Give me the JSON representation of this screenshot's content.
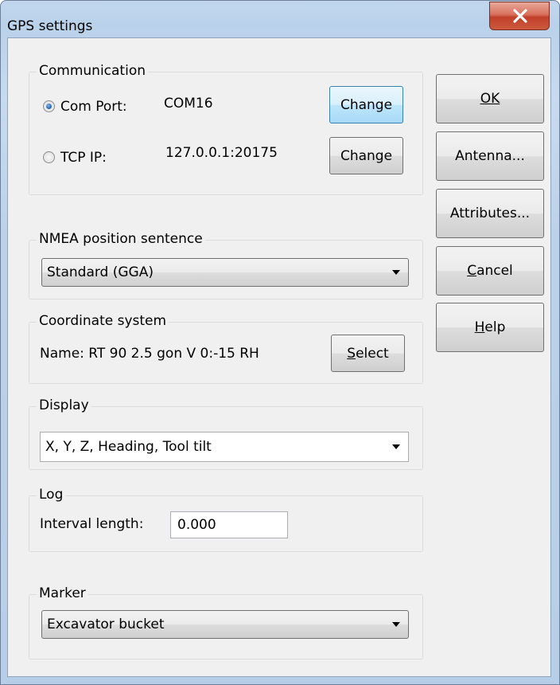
{
  "window": {
    "title": "GPS settings"
  },
  "communication": {
    "label": "Communication",
    "com_port": {
      "label": "Com Port:",
      "value": "COM16",
      "selected": true,
      "change_label": "Change"
    },
    "tcp_ip": {
      "label": "TCP IP:",
      "value": "127.0.0.1:20175",
      "selected": false,
      "change_label": "Change"
    }
  },
  "nmea": {
    "label": "NMEA position sentence",
    "selected": "Standard (GGA)"
  },
  "coordinate_system": {
    "label": "Coordinate system",
    "name_text": "Name:  RT 90 2.5 gon V 0:-15 RH",
    "select_label": "Select"
  },
  "display": {
    "label": "Display",
    "selected": "X, Y, Z, Heading, Tool tilt"
  },
  "log": {
    "label": "Log",
    "interval_label": "Interval length:",
    "interval_value": "0.000"
  },
  "marker": {
    "label": "Marker",
    "selected": "Excavator bucket"
  },
  "side_buttons": {
    "ok": "OK",
    "antenna": "Antenna...",
    "attributes": "Attributes...",
    "cancel": "Cancel",
    "help": "Help"
  },
  "colors": {
    "close_button": "#c8462f",
    "dialog_bg": "#f0f0f0",
    "frame": "#b9d1ea"
  }
}
